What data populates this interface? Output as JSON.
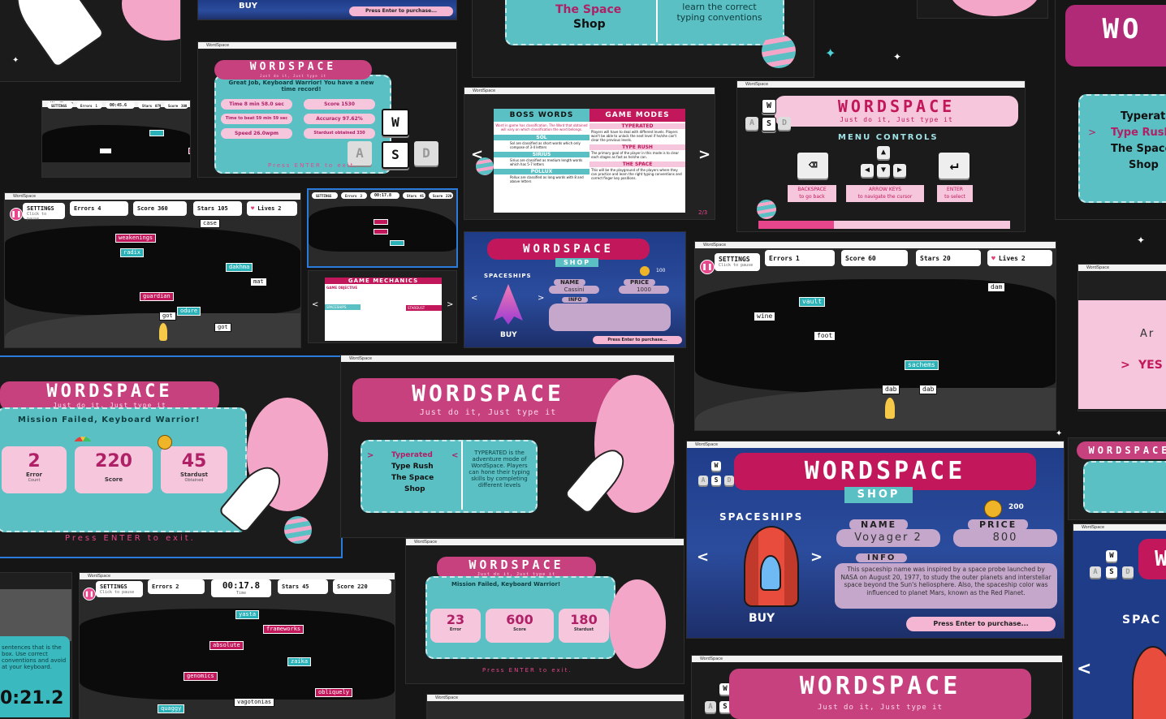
{
  "app_title": "WordSpace",
  "logo": {
    "name": "WORDSPACE",
    "tagline": "Just do it, Just type it"
  },
  "top_strip": {
    "buy_label": "BUY",
    "purchase_prompt": "Press Enter to purchase...",
    "menu_items": [
      "The Space",
      "Shop"
    ],
    "desc": "learn the correct typing conventions"
  },
  "results_small": {
    "heading": "Great Job, Keyboard Warrior! You have a new time record!",
    "rows": [
      {
        "label": "Time",
        "value": "8 min 58.0 sec"
      },
      {
        "label": "Time to beat",
        "value": "59 min 59 sec"
      },
      {
        "label": "Speed",
        "value": "26.0wpm"
      }
    ],
    "right_rows": [
      {
        "label": "Score",
        "value": "1530"
      },
      {
        "label": "Accuracy",
        "value": "97.62%"
      },
      {
        "label": "Stardust obtained",
        "value": "330"
      }
    ],
    "exit_prompt": "Press ENTER to exit."
  },
  "keys": {
    "w": "W",
    "a": "A",
    "s": "S",
    "d": "D"
  },
  "game_a": {
    "settings_label": "SETTINGS",
    "settings_sub": "Click to pause",
    "errors_label": "Errors",
    "errors_sub": "Count",
    "errors": "4",
    "score_label": "Score",
    "score": "360",
    "stars_label": "Stars",
    "stars_sub": "Dust",
    "stars": "105",
    "lives_label": "Lives",
    "lives": "2",
    "words": [
      "weakenings",
      "radix",
      "dakhma",
      "mat",
      "case",
      "guardian",
      "got",
      "odure",
      "got"
    ]
  },
  "game_b": {
    "errors": "1",
    "time": "00:45.6",
    "stars": "079",
    "score": "300"
  },
  "game_c": {
    "errors": "3",
    "time": "00:17.8",
    "stars": "45",
    "score": "220"
  },
  "boss_words": {
    "title": "BOSS WORDS",
    "entries": [
      {
        "name": "SOL",
        "desc": "Sol are classified as short words which only compose of 3-4 letters"
      },
      {
        "name": "SIRIUS",
        "desc": "Sirius are classified as medium length words which has 5-7 letters"
      },
      {
        "name": "POLLUX",
        "desc": "Pollux are classified as long words with 8 and above letters"
      }
    ],
    "intro": "Word in game has classification. The Word that obtained will vary on which classification the word belongs."
  },
  "game_modes": {
    "title": "GAME MODES",
    "entries": [
      {
        "name": "TYPERATED",
        "desc": "Players will have to deal with different levels. Players won't be able to unlock the next level if he/she can't clear the previous levels."
      },
      {
        "name": "TYPE RUSH",
        "desc": "The primary goal of the player in this mode is to clear each stages as fast as he/she can."
      },
      {
        "name": "THE SPACE",
        "desc": "This will be the playground of the players where they can practice and learn the right typing conventions and correct finger key positions."
      }
    ],
    "page": "2/3"
  },
  "menu_controls": {
    "title": "MENU CONTROLS",
    "backspace": "BACKSPACE",
    "backspace_sub": "to go back",
    "arrows": "ARROW KEYS",
    "arrows_sub": "to navigate the cursor",
    "enter": "ENTER",
    "enter_sub": "to select"
  },
  "mechanics": {
    "title": "GAME MECHANICS",
    "objective": "GAME OBJECTIVE",
    "spaceships": "SPACESHIPS",
    "stardust": "STARDUST"
  },
  "shop_small": {
    "shop_label": "SHOP",
    "spaceships_label": "SPACESHIPS",
    "name_label": "NAME",
    "name": "Cassini",
    "price_label": "PRICE",
    "price": "1000",
    "coins": "100",
    "info_label": "INFO",
    "buy": "BUY",
    "purchase_prompt": "Press Enter to purchase..."
  },
  "shop_large": {
    "shop_label": "SHOP",
    "spaceships_label": "SPACESHIPS",
    "name_label": "NAME",
    "name": "Voyager 2",
    "price_label": "PRICE",
    "price": "800",
    "coins": "200",
    "info_label": "INFO",
    "info": "This spaceship name was inspired by a space probe launched by NASA on August 20, 1977, to study the outer planets and interstellar space beyond the Sun's heliosphere. Also, the spaceship color was influenced to planet Mars, known as the Red Planet.",
    "buy": "BUY",
    "purchase_prompt": "Press Enter to purchase..."
  },
  "game_d": {
    "settings_label": "SETTINGS",
    "settings_sub": "Click to pause",
    "errors_label": "Errors",
    "errors_sub": "Count",
    "errors": "1",
    "score_label": "Score",
    "score": "60",
    "stars_label": "Stars",
    "stars_sub": "Dust",
    "stars": "20",
    "lives_label": "Lives",
    "lives": "2",
    "words": [
      "dam",
      "vault",
      "wine",
      "foot",
      "sachems",
      "dab",
      "dab"
    ]
  },
  "mission_failed": {
    "heading": "Mission Failed, Keyboard Warrior!",
    "error": "2",
    "error_label": "Error",
    "error_sub": "Count",
    "score": "220",
    "score_label": "Score",
    "stardust": "45",
    "stardust_label": "Stardust",
    "stardust_sub": "Obtained",
    "exit_prompt": "Press ENTER to exit."
  },
  "mission_failed_2": {
    "heading": "Mission Failed, Keyboard Warrior!",
    "error": "23",
    "score": "600",
    "stardust": "180",
    "exit_prompt": "Press ENTER to exit."
  },
  "main_menu": {
    "items": [
      "Typerated",
      "Type Rush",
      "The Space",
      "Shop"
    ],
    "desc": "TYPERATED is the adventure mode of WordSpace. Players can hone their typing skills by completing different levels"
  },
  "right_edge": {
    "items": [
      "Typerated",
      "Type Rush",
      "The Space",
      "Shop"
    ],
    "confirm": "YES",
    "partial": "Ar"
  },
  "game_e": {
    "settings_label": "SETTINGS",
    "settings_sub": "Click to pause",
    "errors_label": "Errors",
    "errors_sub": "Count",
    "errors": "2",
    "time_label": "Time",
    "time": "00:17.8",
    "stars_label": "Stars",
    "stars_sub": "Dust",
    "stars": "45",
    "score_label": "Score",
    "score": "220",
    "words": [
      "yasta",
      "frameworks",
      "absolute",
      "zaika",
      "genomics",
      "obliquely",
      "vagotonias",
      "quaggy"
    ]
  },
  "left_edge": {
    "desc": "sentences that is the box. Use correct conventions and avoid at your keyboard.",
    "time": "0:21.2"
  },
  "colors": {
    "pink": "#c8417f",
    "teal": "#5bc0c4",
    "light_pink": "#f6c6dc",
    "bg": "#1b1b1b"
  }
}
